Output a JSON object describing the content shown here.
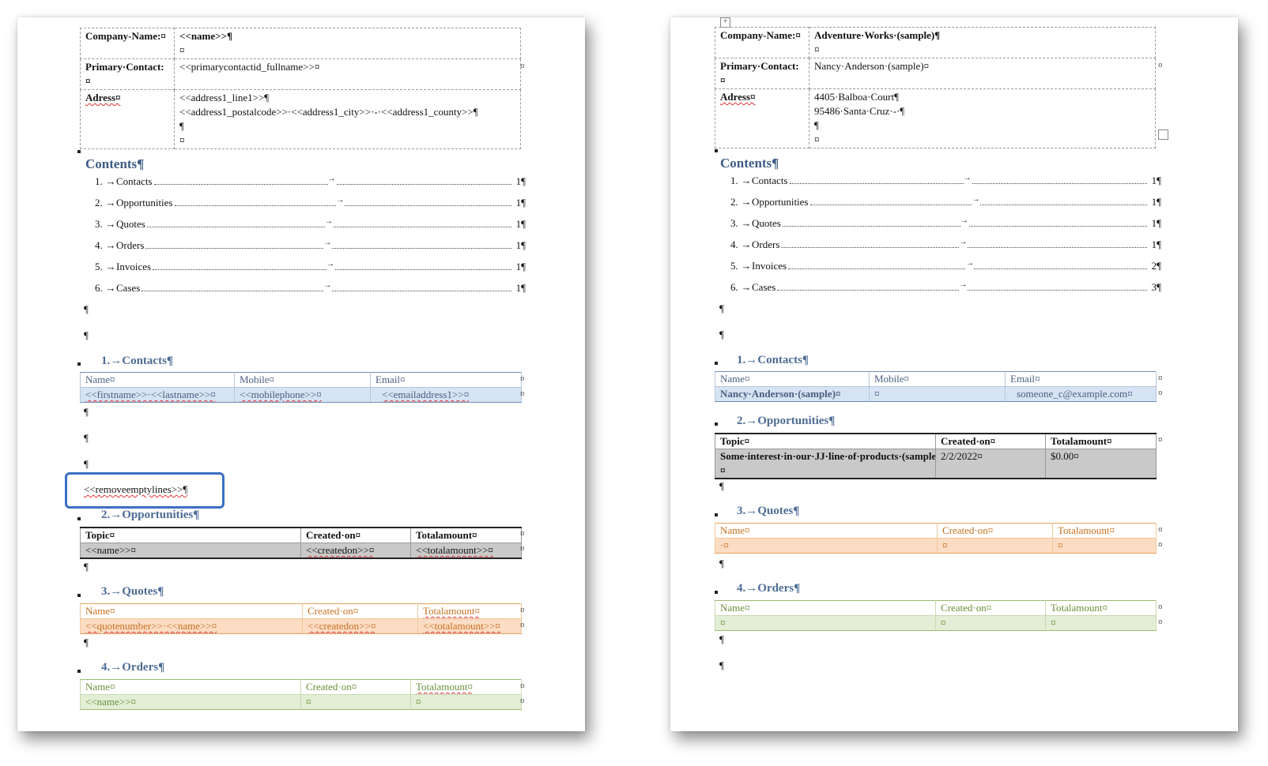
{
  "left": {
    "header": {
      "company_label": "Company-Name:¤",
      "company_value": "<<name>>¶",
      "company_value2": "¤",
      "contact_label": "Primary·Contact:¤",
      "contact_value": "<<primarycontactid_fullname>>¤",
      "address_label": "Adress¤",
      "address_line1": "<<address1_line1>>¶",
      "address_line2": "<<address1_postalcode>>·<<address1_city>>·-·<<address1_county>>¶",
      "address_line3": "¶",
      "address_line4": "¤"
    },
    "toc": {
      "title": "Contents¶",
      "items": [
        {
          "num": "1.",
          "label": "Contacts",
          "page": "1¶"
        },
        {
          "num": "2.",
          "label": "Opportunities",
          "page": "1¶"
        },
        {
          "num": "3.",
          "label": "Quotes",
          "page": "1¶"
        },
        {
          "num": "4.",
          "label": "Orders",
          "page": "1¶"
        },
        {
          "num": "5.",
          "label": "Invoices",
          "page": "1¶"
        },
        {
          "num": "6.",
          "label": "Cases",
          "page": "1¶"
        }
      ]
    },
    "sections": {
      "contacts": {
        "title": "1.→Contacts¶",
        "headers": [
          "Name¤",
          "Mobile¤",
          "Email¤"
        ],
        "row": [
          "<<firstname>>·<<lastname>>¤",
          "<<mobilephone>>¤",
          "<<emailaddress1>>¤"
        ]
      },
      "remove_tag": "<<removeemptylines>>¶",
      "opportunities": {
        "title": "2.→Opportunities¶",
        "headers": [
          "Topic¤",
          "Created·on¤",
          "Totalamount¤"
        ],
        "row": [
          "<<name>>¤",
          "<<createdon>>¤",
          "<<totalamount>>¤"
        ]
      },
      "quotes": {
        "title": "3.→Quotes¶",
        "headers": [
          "Name¤",
          "Created·on¤",
          "Totalamount¤"
        ],
        "row": [
          "<<quotenumber>>·<<name>>¤",
          "<<createdon>>¤",
          "<<totalamount>>¤"
        ]
      },
      "orders": {
        "title": "4.→Orders¶",
        "headers": [
          "Name¤",
          "Created·on¤",
          "Totalamount¤"
        ],
        "row": [
          "<<name>>¤",
          "¤",
          "¤"
        ]
      }
    }
  },
  "right": {
    "header": {
      "company_label": "Company-Name:¤",
      "company_value": "Adventure·Works·(sample)¶",
      "company_value2": "¤",
      "contact_label": "Primary·Contact:¤",
      "contact_value": "Nancy·Anderson·(sample)¤",
      "address_label": "Adress¤",
      "address_line1": "4405·Balboa·Court¶",
      "address_line2": "95486·Santa·Cruz·-·¶",
      "address_line3": "¶",
      "address_line4": "¤"
    },
    "toc": {
      "title": "Contents¶",
      "items": [
        {
          "num": "1.",
          "label": "Contacts",
          "page": "1¶"
        },
        {
          "num": "2.",
          "label": "Opportunities",
          "page": "1¶"
        },
        {
          "num": "3.",
          "label": "Quotes",
          "page": "1¶"
        },
        {
          "num": "4.",
          "label": "Orders",
          "page": "1¶"
        },
        {
          "num": "5.",
          "label": "Invoices",
          "page": "2¶"
        },
        {
          "num": "6.",
          "label": "Cases",
          "page": "3¶"
        }
      ]
    },
    "sections": {
      "contacts": {
        "title": "1.→Contacts¶",
        "headers": [
          "Name¤",
          "Mobile¤",
          "Email¤"
        ],
        "row": [
          "Nancy·Anderson·(sample)¤",
          "¤",
          "someone_c@example.com¤"
        ]
      },
      "opportunities": {
        "title": "2.→Opportunities¶",
        "headers": [
          "Topic¤",
          "Created·on¤",
          "Totalamount¤"
        ],
        "row": [
          "Some·interest·in·our·JJ·line·of·products·(sample)¤",
          "2/2/2022¤",
          "$0.00¤"
        ]
      },
      "quotes": {
        "title": "3.→Quotes¶",
        "headers": [
          "Name¤",
          "Created·on¤",
          "Totalamount¤"
        ],
        "row": [
          "·¤",
          "¤",
          "¤"
        ]
      },
      "orders": {
        "title": "4.→Orders¶",
        "headers": [
          "Name¤",
          "Created·on¤",
          "Totalamount¤"
        ],
        "row": [
          "¤",
          "¤",
          "¤"
        ]
      }
    }
  },
  "marks": {
    "pilcrow": "¶",
    "cell_end": "¤",
    "arrow": "→",
    "move_handle": "+"
  }
}
